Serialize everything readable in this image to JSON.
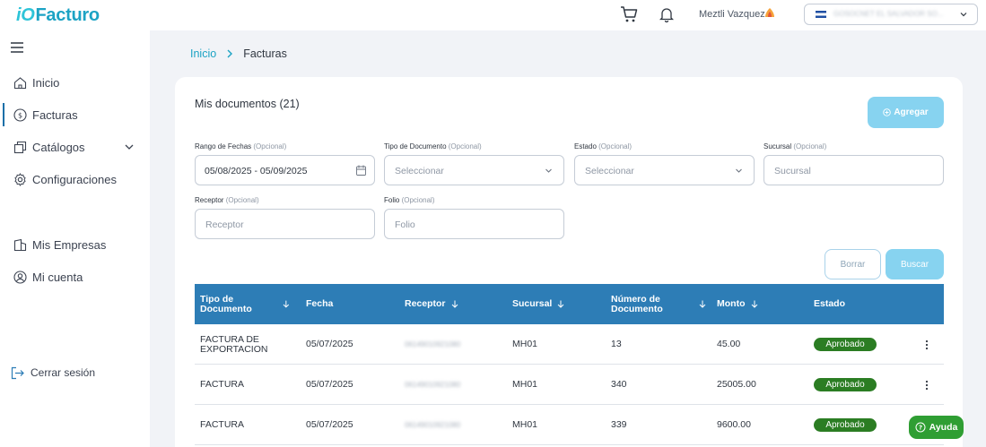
{
  "app": {
    "logo_prefix": "iO",
    "logo_name": "Facturo"
  },
  "header": {
    "user_name": "Meztli Vazquez",
    "company": "GOSOCNET EL SALVADOR SO..."
  },
  "sidebar": {
    "items": [
      {
        "label": "Inicio",
        "icon": "home-icon"
      },
      {
        "label": "Facturas",
        "icon": "dollar-circle-icon",
        "active": true
      },
      {
        "label": "Catálogos",
        "icon": "copy-icon"
      },
      {
        "label": "Configuraciones",
        "icon": "gear-icon"
      },
      {
        "label": "Mis Empresas",
        "icon": "building-icon"
      },
      {
        "label": "Mi cuenta",
        "icon": "user-circle-icon"
      },
      {
        "label": "Cerrar sesión",
        "icon": "logout-icon"
      }
    ]
  },
  "breadcrumb": {
    "home": "Inicio",
    "current": "Facturas"
  },
  "card": {
    "title": "Mis documentos (21)",
    "add_button": "Agregar"
  },
  "filters": {
    "optional": "(Opcional)",
    "date_range": {
      "label": "Rango de Fechas",
      "value": "05/08/2025 - 05/09/2025"
    },
    "doc_type": {
      "label": "Tipo de Documento",
      "placeholder": "Seleccionar"
    },
    "status": {
      "label": "Estado",
      "placeholder": "Seleccionar"
    },
    "branch": {
      "label": "Sucursal",
      "placeholder": "Sucursal"
    },
    "receiver": {
      "label": "Receptor",
      "placeholder": "Receptor"
    },
    "folio": {
      "label": "Folio",
      "placeholder": "Folio"
    },
    "clear_button": "Borrar",
    "search_button": "Buscar"
  },
  "table": {
    "columns": [
      "Tipo de Documento",
      "Fecha",
      "Receptor",
      "Sucursal",
      "Número de Documento",
      "Monto",
      "Estado"
    ],
    "rows": [
      {
        "tipo": "FACTURA DE EXPORTACION",
        "fecha": "05/07/2025",
        "receptor": "06149010921080",
        "sucursal": "MH01",
        "numero": "13",
        "monto": "45.00",
        "estado": "Aprobado"
      },
      {
        "tipo": "FACTURA",
        "fecha": "05/07/2025",
        "receptor": "06149010921080",
        "sucursal": "MH01",
        "numero": "340",
        "monto": "25005.00",
        "estado": "Aprobado"
      },
      {
        "tipo": "FACTURA",
        "fecha": "05/07/2025",
        "receptor": "06149010921080",
        "sucursal": "MH01",
        "numero": "339",
        "monto": "9600.00",
        "estado": "Aprobado"
      }
    ]
  },
  "help_button": "Ayuda",
  "colors": {
    "accent": "#1ca3c4",
    "table_header": "#2d7db6",
    "button_light": "#87d3f0",
    "status_approved": "#2b7d23",
    "help": "#2f9e33"
  }
}
